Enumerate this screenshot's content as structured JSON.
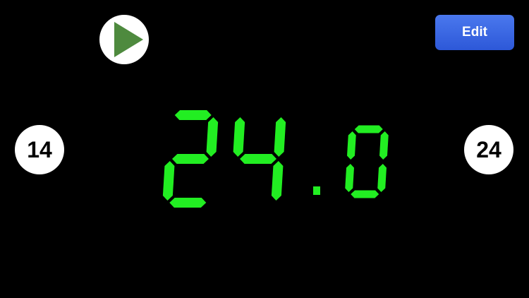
{
  "controls": {
    "edit_label": "Edit",
    "play_icon": "play-icon",
    "reset_left_label": "14",
    "reset_right_label": "24"
  },
  "timer": {
    "value": "24.0",
    "digit_color": "#22ee22"
  },
  "colors": {
    "background": "#000000",
    "edit_button": "#3a68e4",
    "play_triangle": "#4e8a3e",
    "button_face": "#ffffff"
  }
}
